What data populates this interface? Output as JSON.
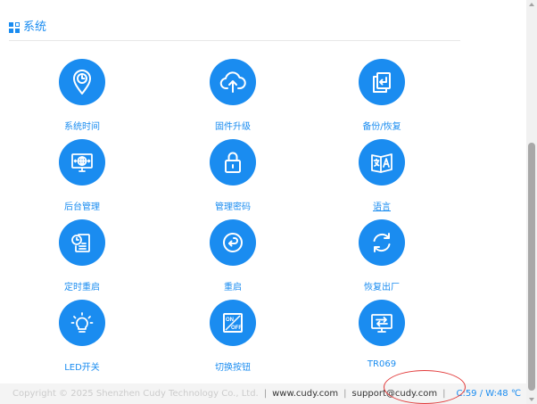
{
  "section": {
    "title": "系统",
    "icon": "grid-icon"
  },
  "tiles": [
    {
      "label": "系统时间",
      "icon": "clock-pin-icon"
    },
    {
      "label": "固件升级",
      "icon": "cloud-upload-icon"
    },
    {
      "label": "备份/恢复",
      "icon": "backup-icon"
    },
    {
      "label": "后台管理",
      "icon": "monitor-globe-icon"
    },
    {
      "label": "管理密码",
      "icon": "lock-icon"
    },
    {
      "label": "语言",
      "icon": "translate-icon"
    },
    {
      "label": "定时重启",
      "icon": "scheduled-reboot-icon"
    },
    {
      "label": "重启",
      "icon": "reboot-icon"
    },
    {
      "label": "恢复出厂",
      "icon": "factory-reset-icon"
    },
    {
      "label": "LED开关",
      "icon": "led-bulb-icon"
    },
    {
      "label": "切换按钮",
      "icon": "switch-button-icon"
    },
    {
      "label": "TR069",
      "icon": "tr069-monitor-icon"
    }
  ],
  "switch_icon": {
    "on": "ON",
    "off": "OFF"
  },
  "footer": {
    "copyright": "Copyright © 2025 Shenzhen Cudy Technology Co., Ltd.",
    "separator": "|",
    "website": "www.cudy.com",
    "email": "support@cudy.com",
    "temperature": "C:59 / W:48 ℃"
  },
  "colors": {
    "accent": "#1a8cf0",
    "annotation": "#e23b3b"
  }
}
